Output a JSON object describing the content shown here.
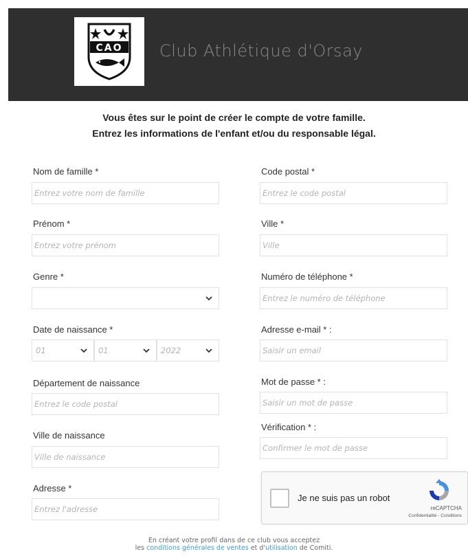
{
  "header": {
    "logo_text": "CAO",
    "club_name": "Club Athlétique d'Orsay"
  },
  "intro": {
    "line1_pre": "Vous êtes sur le ",
    "line1_bold": "point de créer le compte de votre famille.",
    "line2": "Entrez les informations de l'enfant et/ou du responsable légal."
  },
  "left": {
    "nom": {
      "label": "Nom de famille *",
      "placeholder": "Entrez votre nom de famille"
    },
    "prenom": {
      "label": "Prénom *",
      "placeholder": "Entrez votre prénom"
    },
    "genre": {
      "label": "Genre *",
      "value": ""
    },
    "date": {
      "label": "Date de naissance *",
      "day": "01",
      "month": "01",
      "year": "2022"
    },
    "departement": {
      "label": "Département de naissance",
      "placeholder": "Entrez le code postal"
    },
    "ville_naissance": {
      "label": "Ville de naissance",
      "placeholder": "Ville de naissance"
    },
    "adresse": {
      "label": "Adresse *",
      "placeholder": "Entrez l'adresse"
    }
  },
  "right": {
    "code_postal": {
      "label": "Code postal *",
      "placeholder": "Entrez le code postal"
    },
    "ville": {
      "label": "Ville *",
      "placeholder": "Ville"
    },
    "telephone": {
      "label": "Numéro de téléphone *",
      "placeholder": "Entrez le numéro de téléphone"
    },
    "email": {
      "label": "Adresse e-mail * :",
      "placeholder": "Saisir un email"
    },
    "password": {
      "label": "Mot de passe * :",
      "placeholder": "Saisir un mot de passe"
    },
    "verification": {
      "label": "Vérification * :",
      "placeholder": "Confirmer le mot de passe"
    }
  },
  "captcha": {
    "label": "Je ne suis pas un robot",
    "brand": "reCAPTCHA",
    "privacy": "Confidentialité",
    "sep": " - ",
    "terms": "Conditions"
  },
  "footer": {
    "line1": "En créant votre profil dans de ce club vous acceptez",
    "line2_pre": "les ",
    "cgv_link": "conditions générales de ventes",
    "line2_mid": " et d'",
    "util_link": "utilisation",
    "line2_post": " de Comiti."
  },
  "colors": {
    "header_bg": "#2f2f2f",
    "link": "#3a9bd9",
    "club_name": "#8a8a8a"
  }
}
